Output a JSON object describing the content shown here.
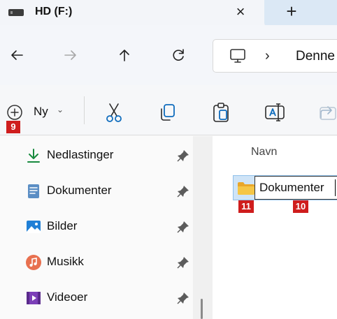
{
  "window": {
    "tab_title": "HD (F:)",
    "tab_close": "×",
    "new_tab": "+",
    "drive_icon": "drive-icon"
  },
  "nav": {
    "address_chevron": "›",
    "address_text": "Denne",
    "buttons": [
      "back-arrow-icon",
      "forward-arrow-icon",
      "up-arrow-icon",
      "refresh-icon"
    ]
  },
  "command_bar": {
    "new_label": "Ny",
    "new_chevron": "⌄",
    "buttons": [
      "cut-icon",
      "copy-icon",
      "paste-icon",
      "rename-icon",
      "share-icon"
    ],
    "badges": {
      "new": "9"
    }
  },
  "sidebar": {
    "items": [
      {
        "label": "Nedlastinger",
        "icon": "download-icon",
        "pinned": true
      },
      {
        "label": "Dokumenter",
        "icon": "documents-icon",
        "pinned": true
      },
      {
        "label": "Bilder",
        "icon": "pictures-icon",
        "pinned": true
      },
      {
        "label": "Musikk",
        "icon": "music-icon",
        "pinned": true
      },
      {
        "label": "Videoer",
        "icon": "videos-icon",
        "pinned": true
      }
    ]
  },
  "content": {
    "column_header": "Navn",
    "rename_value": "Dokumenter",
    "badges": {
      "folder": "11",
      "rename": "10"
    }
  },
  "colors": {
    "accent": "#0067c0",
    "badge": "#cf1d1d",
    "selection": "#cfe4f7",
    "folder": "#f5c646"
  }
}
